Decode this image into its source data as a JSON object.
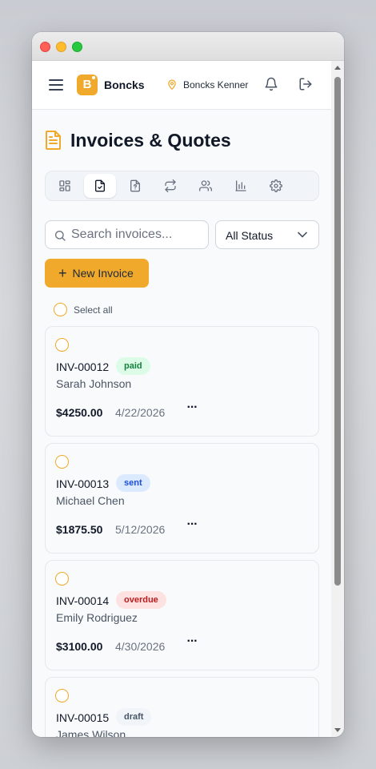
{
  "header": {
    "brand_letter": "B",
    "brand_name": "Boncks",
    "location": "Boncks Kenner"
  },
  "page": {
    "title": "Invoices & Quotes"
  },
  "tabs": [
    {
      "name": "dashboard-icon",
      "active": false
    },
    {
      "name": "invoice-icon",
      "active": true
    },
    {
      "name": "quote-icon",
      "active": false
    },
    {
      "name": "recurring-icon",
      "active": false
    },
    {
      "name": "clients-icon",
      "active": false
    },
    {
      "name": "reports-icon",
      "active": false
    },
    {
      "name": "settings-icon",
      "active": false
    }
  ],
  "search": {
    "placeholder": "Search invoices..."
  },
  "status_filter": {
    "selected": "All Status"
  },
  "new_invoice_label": "New Invoice",
  "select_all_label": "Select all",
  "colors": {
    "accent": "#f0a92b",
    "paid_bg": "#dcfce7",
    "paid_fg": "#15803d",
    "sent_bg": "#dbeafe",
    "sent_fg": "#1d4ed8",
    "overdue_bg": "#fee2e2",
    "overdue_fg": "#b91c1c",
    "draft_bg": "#f1f5f9",
    "draft_fg": "#475569"
  },
  "invoices": [
    {
      "number": "INV-00012",
      "status": "paid",
      "client": "Sarah Johnson",
      "amount": "$4250.00",
      "date": "4/22/2026",
      "more": "···"
    },
    {
      "number": "INV-00013",
      "status": "sent",
      "client": "Michael Chen",
      "amount": "$1875.50",
      "date": "5/12/2026",
      "more": "···"
    },
    {
      "number": "INV-00014",
      "status": "overdue",
      "client": "Emily Rodriguez",
      "amount": "$3100.00",
      "date": "4/30/2026",
      "more": "···"
    },
    {
      "number": "INV-00015",
      "status": "draft",
      "client": "James Wilson",
      "amount": "",
      "date": "",
      "more": ""
    }
  ]
}
